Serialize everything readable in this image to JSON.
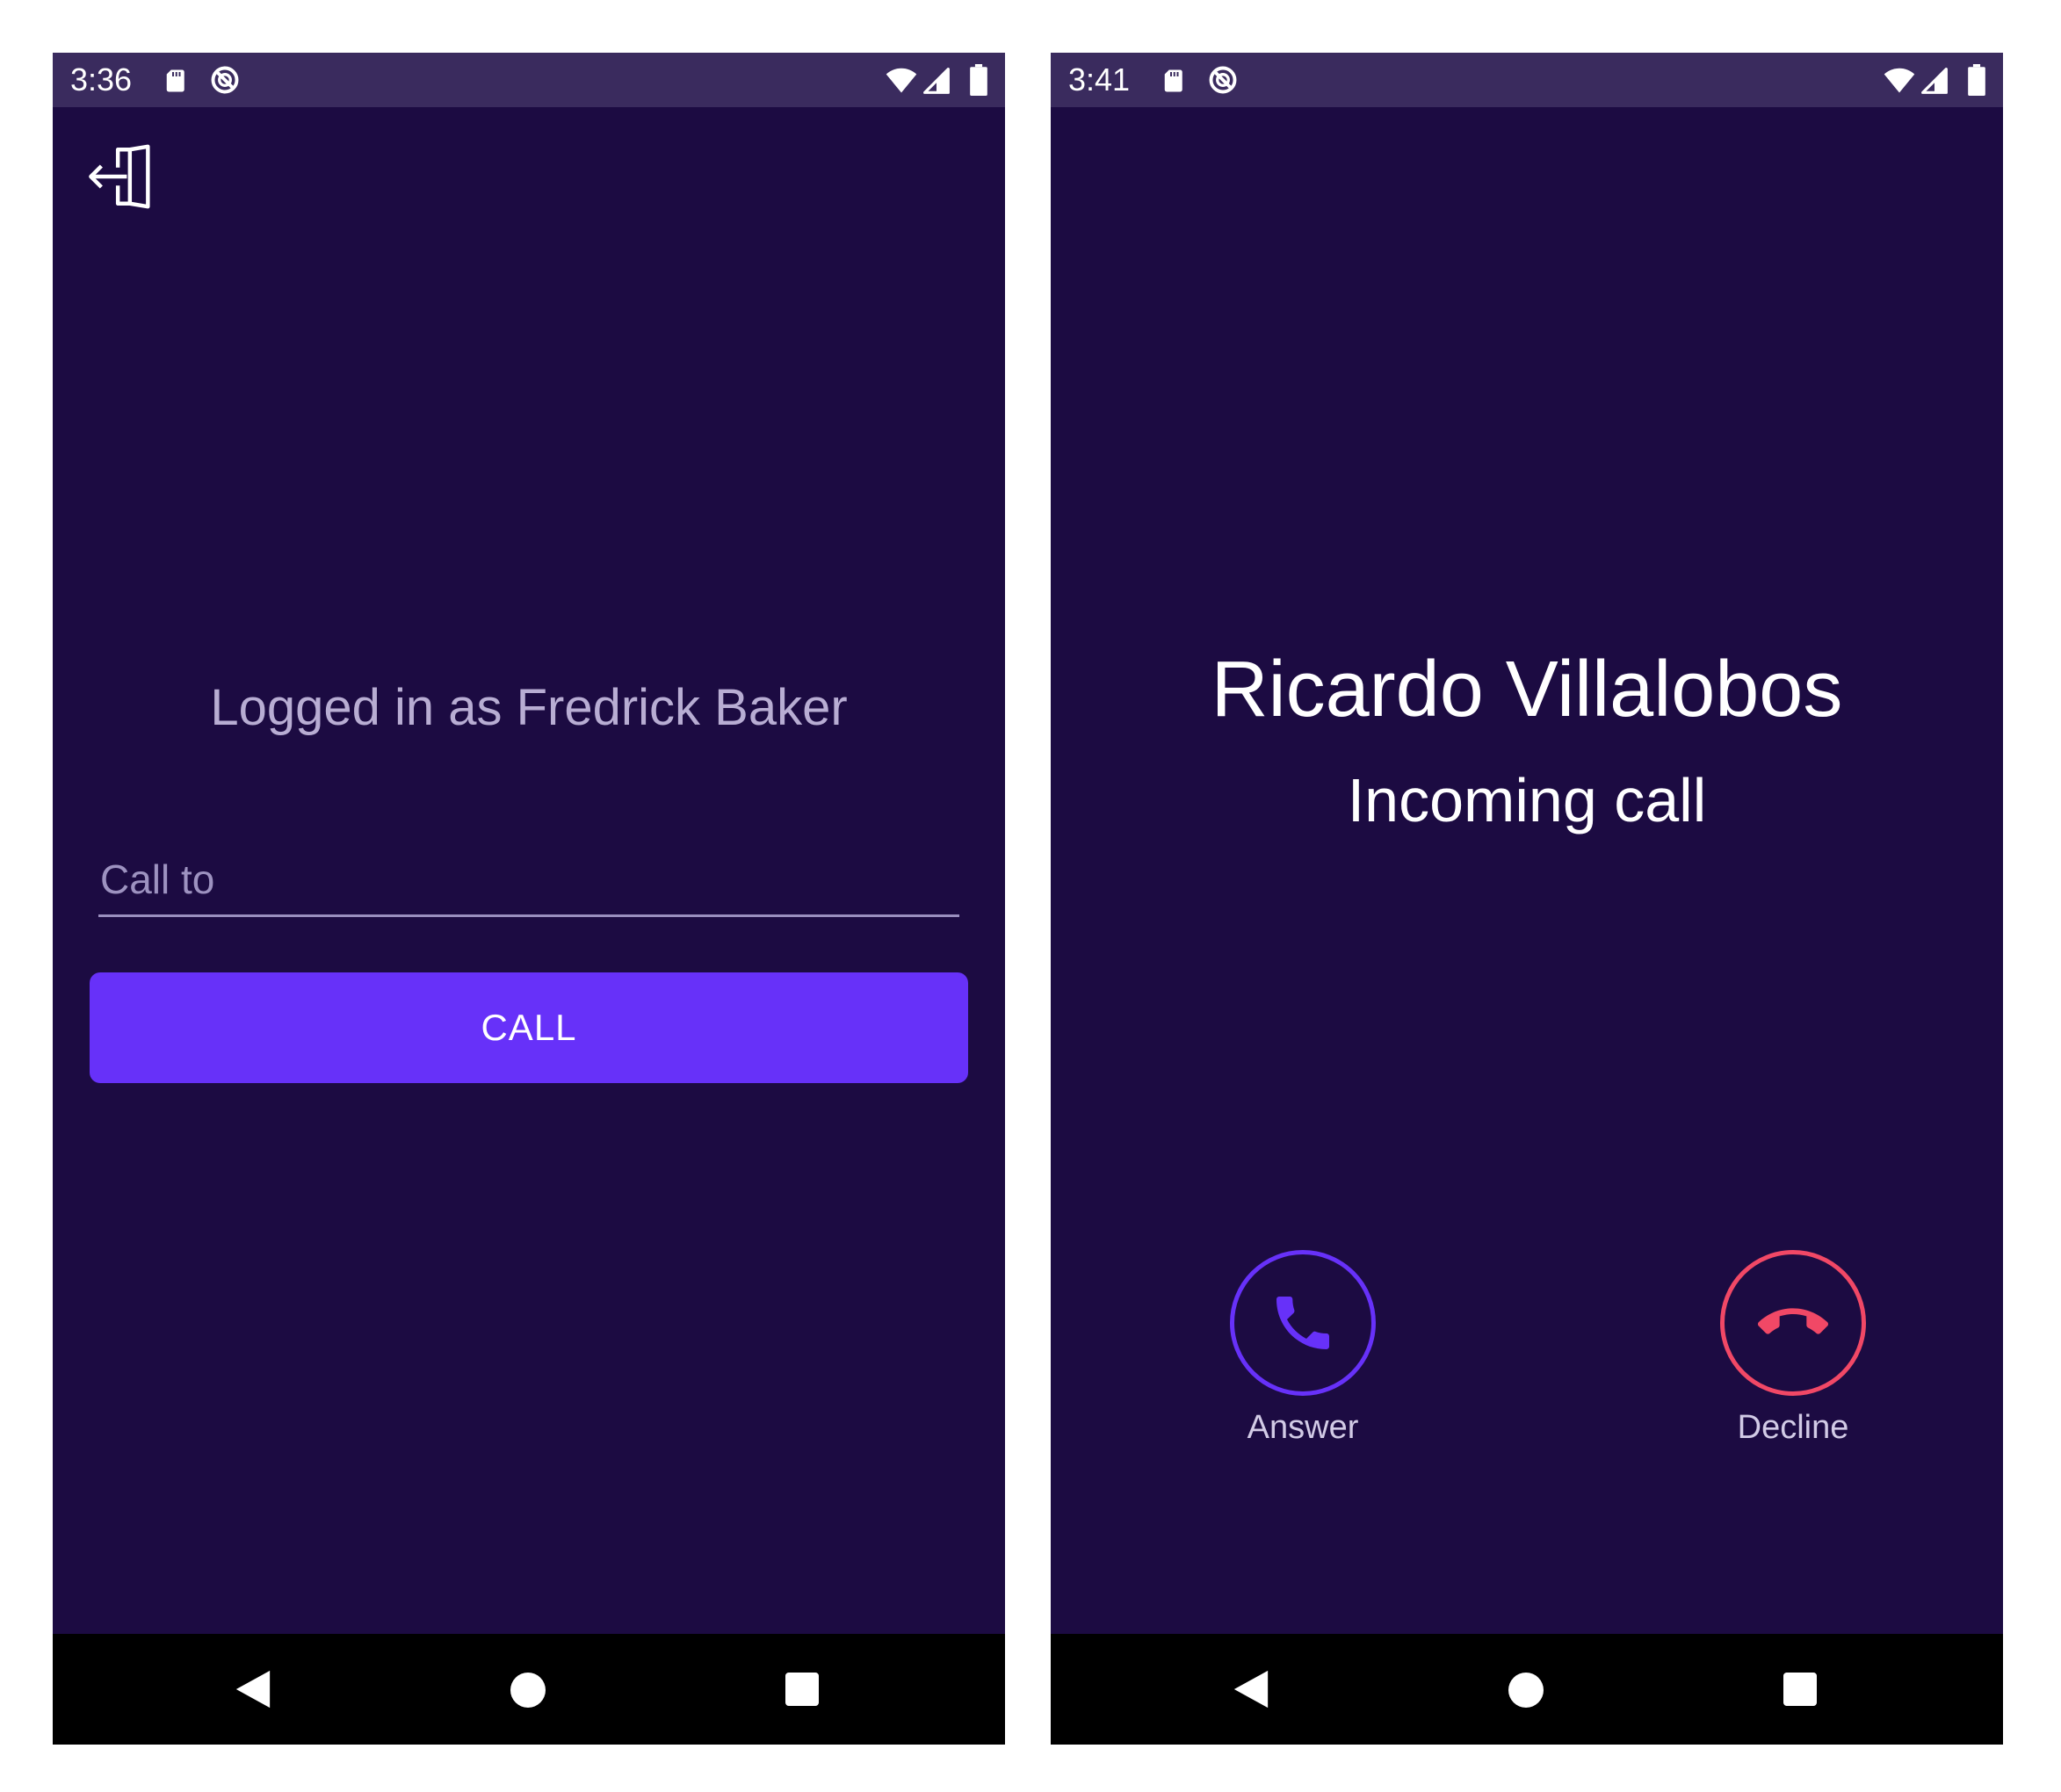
{
  "colors": {
    "background": "#1c0b42",
    "status_bar": "#3a2b5e",
    "accent": "#6731f9",
    "decline": "#f14866",
    "nav_bar": "#000000"
  },
  "screens": {
    "login": {
      "status_bar": {
        "time": "3:36",
        "icons": [
          "sd-card-icon",
          "do-not-disturb-icon",
          "wifi-icon",
          "signal-icon",
          "battery-icon"
        ]
      },
      "logout_icon": "logout-icon",
      "logged_in_text": "Logged in as Fredrick Baker",
      "call_to": {
        "placeholder": "Call to",
        "value": ""
      },
      "call_button_label": "CALL",
      "nav_icons": [
        "back-icon",
        "home-icon",
        "recents-icon"
      ]
    },
    "incoming_call": {
      "status_bar": {
        "time": "3:41",
        "icons": [
          "sd-card-icon",
          "do-not-disturb-icon",
          "wifi-icon",
          "signal-icon",
          "battery-icon"
        ]
      },
      "caller_name": "Ricardo Villalobos",
      "call_status": "Incoming call",
      "answer": {
        "icon": "phone-icon",
        "label": "Answer"
      },
      "decline": {
        "icon": "phone-hangup-icon",
        "label": "Decline"
      },
      "nav_icons": [
        "back-icon",
        "home-icon",
        "recents-icon"
      ]
    }
  }
}
